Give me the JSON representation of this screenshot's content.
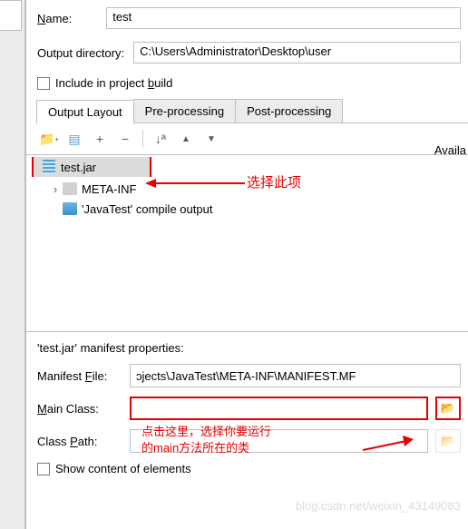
{
  "form": {
    "name_label_pre": "N",
    "name_label_post": "ame:",
    "name_value": "test",
    "outdir_label": "Output directory:",
    "outdir_value": "C:\\Users\\Administrator\\Desktop\\user",
    "include_pre": "Include in project ",
    "include_u": "b",
    "include_post": "uild"
  },
  "tabs": {
    "t1": "Output Layout",
    "t2": "Pre-processing",
    "t3": "Post-processing"
  },
  "toolbar": {
    "add_folder": "📁",
    "archive": "≡",
    "plus": "+",
    "minus": "−",
    "sort": "↓ª",
    "up": "▲",
    "down": "▼"
  },
  "available_label": "Availa",
  "tree": {
    "jar": "test.jar",
    "metainf": "META-INF",
    "compile": "'JavaTest' compile output"
  },
  "props": {
    "header": "'test.jar' manifest properties:",
    "manifest_label_pre": "Manifest ",
    "manifest_label_u": "F",
    "manifest_label_post": "ile:",
    "manifest_value": "ɔjects\\JavaTest\\META-INF\\MANIFEST.MF",
    "main_label_u": "M",
    "main_label_post": "ain Class:",
    "main_value": "",
    "classpath_label_pre": "Class ",
    "classpath_label_u": "P",
    "classpath_label_post": "ath:",
    "classpath_value": "",
    "show_content": "Show content of elements"
  },
  "annotations": {
    "a1": "选择此项",
    "a2_l1": "点击这里，选择你要运行",
    "a2_l2": "的main方法所在的类"
  },
  "watermark": "blog.csdn.net/weixin_43149083"
}
